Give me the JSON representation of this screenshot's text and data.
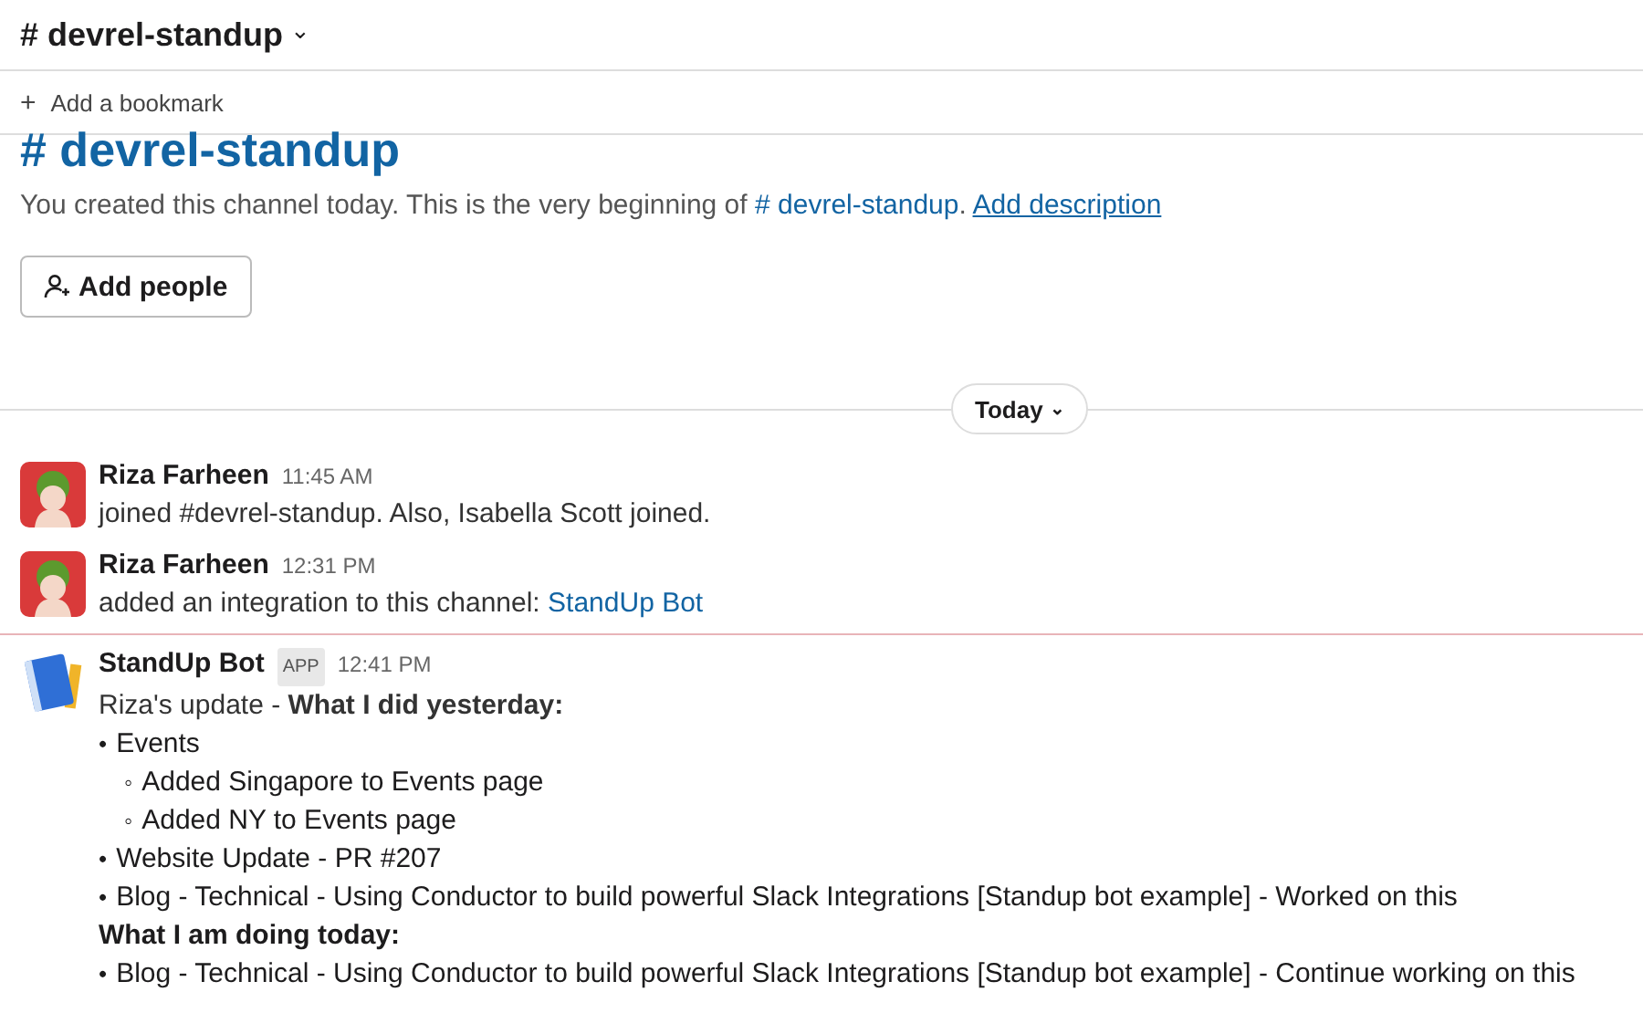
{
  "header": {
    "channel_title": "# devrel-standup",
    "caret": "⌄"
  },
  "bookmark_bar": {
    "icon": "+",
    "label": "Add a bookmark"
  },
  "intro": {
    "title": "# devrel-standup",
    "text": "You created this channel today. This is the very beginning of",
    "channel_link": "# devrel-standup",
    "period": ".",
    "description_link": "Add description",
    "add_people_button": "Add people"
  },
  "date_divider": {
    "label": "Today",
    "caret": "⌄"
  },
  "messages": [
    {
      "kind": "person",
      "author": "Riza Farheen",
      "time": "11:45 AM",
      "text": "joined #devrel-standup. Also, Isabella Scott joined."
    },
    {
      "kind": "person",
      "author": "Riza Farheen",
      "time": "12:31 PM",
      "text": "added an integration to this channel:",
      "link": "StandUp Bot"
    },
    {
      "kind": "bot",
      "author": "StandUp Bot",
      "badge": "APP",
      "time": "12:41 PM",
      "new_divider": true,
      "lines": [
        {
          "kind": "text",
          "text": "Riza's update - **What I did yesterday:**"
        },
        {
          "kind": "bullet",
          "bullet": "•",
          "text": "Events",
          "children": [
            {
              "kind": "bullet",
              "bullet": "◦",
              "text": "Added Singapore to Events page"
            },
            {
              "kind": "bullet",
              "bullet": "◦",
              "text": "Added NY to Events page"
            }
          ]
        },
        {
          "kind": "bullet",
          "bullet": "•",
          "text": "Website Update - PR #207"
        },
        {
          "kind": "bullet",
          "bullet": "•",
          "text": "Blog - Technical - Using Conductor to build powerful Slack Integrations [Standup bot example] - Worked on this"
        },
        {
          "kind": "heading",
          "text": "What I am doing today:"
        },
        {
          "kind": "bullet",
          "bullet": "•",
          "text": "Blog - Technical - Using Conductor to build powerful Slack Integrations [Standup bot example] - Continue working on this"
        }
      ]
    }
  ]
}
